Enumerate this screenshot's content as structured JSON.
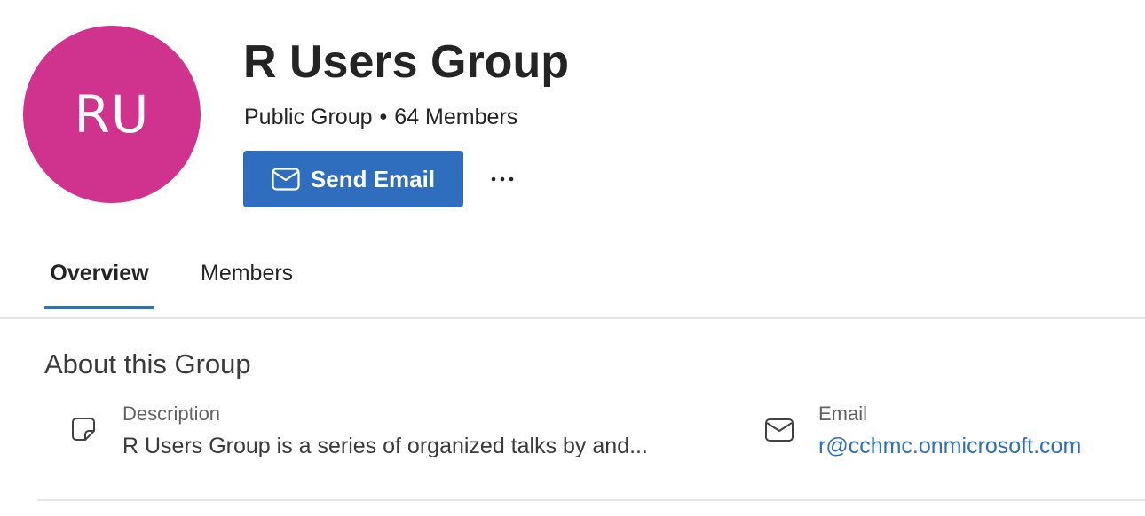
{
  "group": {
    "initials": "RU",
    "avatar_color": "#d0338e",
    "title": "R Users Group",
    "privacy": "Public Group",
    "separator": "•",
    "members_count": "64 Members"
  },
  "actions": {
    "send_email_label": "Send Email",
    "send_email_icon": "mail-icon",
    "more_icon": "more-horizontal-icon",
    "accent_color": "#2f6dbf"
  },
  "tabs": [
    {
      "label": "Overview",
      "active": true
    },
    {
      "label": "Members",
      "active": false
    }
  ],
  "about": {
    "title": "About this Group",
    "description": {
      "icon": "note-icon",
      "label": "Description",
      "value": "R Users Group is a series of organized talks by and..."
    },
    "email": {
      "icon": "mail-icon",
      "label": "Email",
      "value": "r@cchmc.onmicrosoft.com"
    }
  }
}
